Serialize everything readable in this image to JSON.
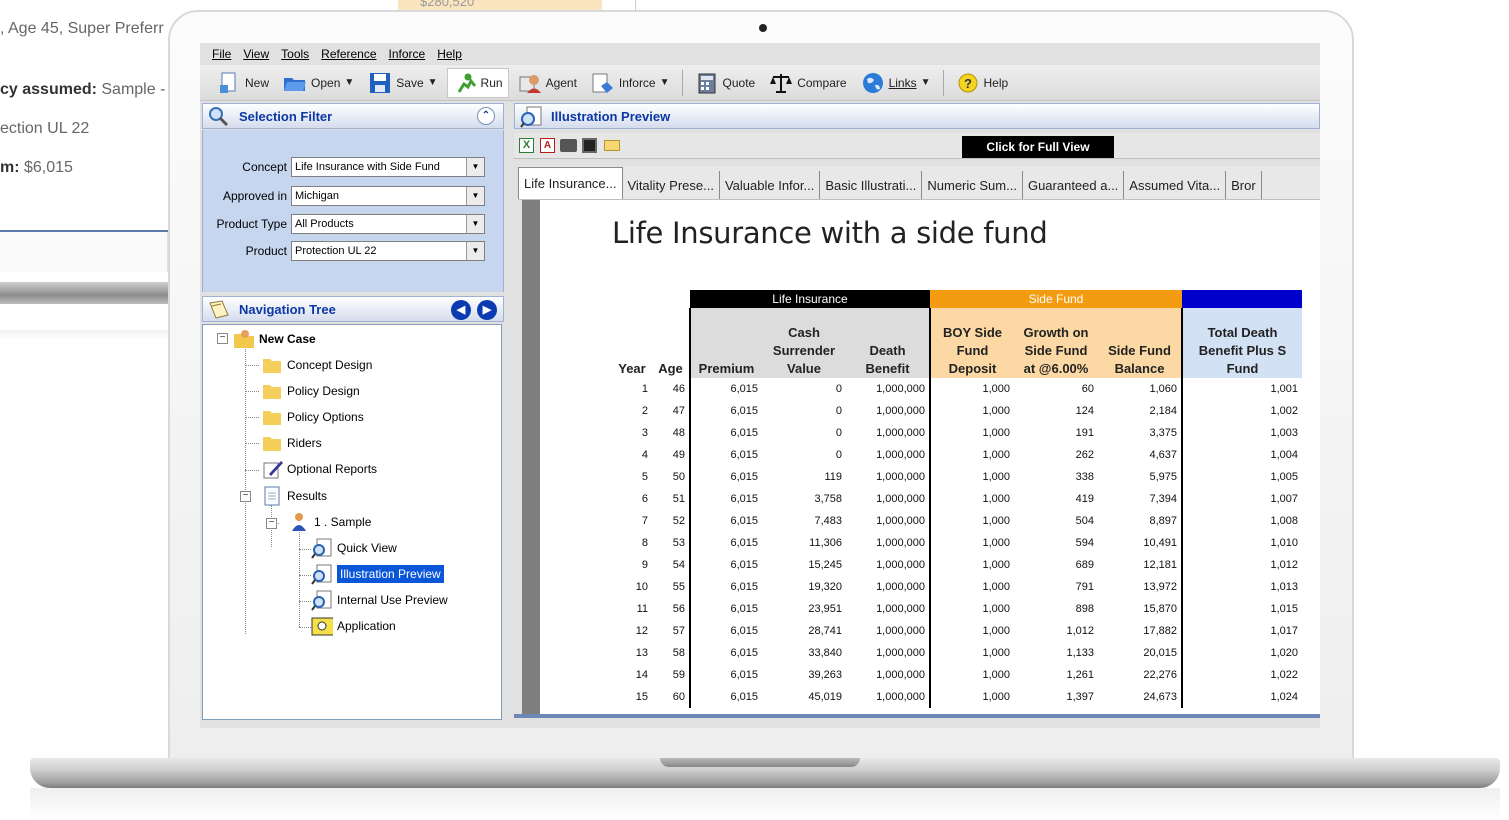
{
  "background": {
    "lines": [
      ", Age 45, Super Preferr",
      "cy assumed: Sample -",
      "ection UL 22",
      "m: $6,015"
    ],
    "bold_parts": [
      "",
      "cy assumed:",
      "",
      "m:"
    ],
    "rest_parts": [
      ", Age 45, Super Preferr",
      " Sample -",
      "ection UL 22",
      " $6,015"
    ],
    "top_snippet": "$280,520"
  },
  "menubar": [
    "File",
    "View",
    "Tools",
    "Reference",
    "Inforce",
    "Help"
  ],
  "toolbar": {
    "new": "New",
    "open": "Open",
    "save": "Save",
    "run": "Run",
    "agent": "Agent",
    "inforce": "Inforce",
    "quote": "Quote",
    "compare": "Compare",
    "links": "Links",
    "help": "Help"
  },
  "selection_filter": {
    "title": "Selection Filter",
    "concept_label": "Concept",
    "concept_value": "Life Insurance with Side Fund",
    "approved_label": "Approved in",
    "approved_value": "Michigan",
    "product_type_label": "Product Type",
    "product_type_value": "All Products",
    "product_label": "Product",
    "product_value": "Protection UL 22"
  },
  "navigation_tree": {
    "title": "Navigation Tree",
    "new_case": "New Case",
    "concept_design": "Concept Design",
    "policy_design": "Policy Design",
    "policy_options": "Policy Options",
    "riders": "Riders",
    "optional_reports": "Optional Reports",
    "results": "Results",
    "sample": "1 . Sample",
    "quick_view": "Quick View",
    "illustration_preview": "Illustration Preview",
    "internal_use": "Internal Use Preview",
    "application": "Application"
  },
  "preview": {
    "title": "Illustration Preview",
    "full_view": "Click for Full View",
    "tabs": [
      "Life Insurance...",
      "Vitality Prese...",
      "Valuable Infor...",
      "Basic Illustrati...",
      "Numeric Sum...",
      "Guaranteed a...",
      "Assumed Vita...",
      "Bror"
    ],
    "doc_title": "Life Insurance with a side fund",
    "group_life": "Life Insurance",
    "group_side": "Side Fund",
    "headers": [
      "Year",
      "Age",
      "Premium",
      "Cash Surrender Value",
      "Death Benefit",
      "BOY Side Fund Deposit",
      "Growth on Side Fund at @6.00%",
      "Side Fund Balance",
      "Total Death Benefit Plus S Fund"
    ],
    "rows": [
      [
        "1",
        "46",
        "6,015",
        "0",
        "1,000,000",
        "1,000",
        "60",
        "1,060",
        "1,001"
      ],
      [
        "2",
        "47",
        "6,015",
        "0",
        "1,000,000",
        "1,000",
        "124",
        "2,184",
        "1,002"
      ],
      [
        "3",
        "48",
        "6,015",
        "0",
        "1,000,000",
        "1,000",
        "191",
        "3,375",
        "1,003"
      ],
      [
        "4",
        "49",
        "6,015",
        "0",
        "1,000,000",
        "1,000",
        "262",
        "4,637",
        "1,004"
      ],
      [
        "5",
        "50",
        "6,015",
        "119",
        "1,000,000",
        "1,000",
        "338",
        "5,975",
        "1,005"
      ],
      [
        "6",
        "51",
        "6,015",
        "3,758",
        "1,000,000",
        "1,000",
        "419",
        "7,394",
        "1,007"
      ],
      [
        "7",
        "52",
        "6,015",
        "7,483",
        "1,000,000",
        "1,000",
        "504",
        "8,897",
        "1,008"
      ],
      [
        "8",
        "53",
        "6,015",
        "11,306",
        "1,000,000",
        "1,000",
        "594",
        "10,491",
        "1,010"
      ],
      [
        "9",
        "54",
        "6,015",
        "15,245",
        "1,000,000",
        "1,000",
        "689",
        "12,181",
        "1,012"
      ],
      [
        "10",
        "55",
        "6,015",
        "19,320",
        "1,000,000",
        "1,000",
        "791",
        "13,972",
        "1,013"
      ],
      [
        "11",
        "56",
        "6,015",
        "23,951",
        "1,000,000",
        "1,000",
        "898",
        "15,870",
        "1,015"
      ],
      [
        "12",
        "57",
        "6,015",
        "28,741",
        "1,000,000",
        "1,000",
        "1,012",
        "17,882",
        "1,017"
      ],
      [
        "13",
        "58",
        "6,015",
        "33,840",
        "1,000,000",
        "1,000",
        "1,133",
        "20,015",
        "1,020"
      ],
      [
        "14",
        "59",
        "6,015",
        "39,263",
        "1,000,000",
        "1,000",
        "1,261",
        "22,276",
        "1,022"
      ],
      [
        "15",
        "60",
        "6,015",
        "45,019",
        "1,000,000",
        "1,000",
        "1,397",
        "24,673",
        "1,024"
      ]
    ]
  },
  "colors": {
    "accent": "#0b38a6",
    "life_group": "#000000",
    "side_group": "#f39c12",
    "total_group": "#0000cc",
    "selected": "#0a56d8"
  }
}
